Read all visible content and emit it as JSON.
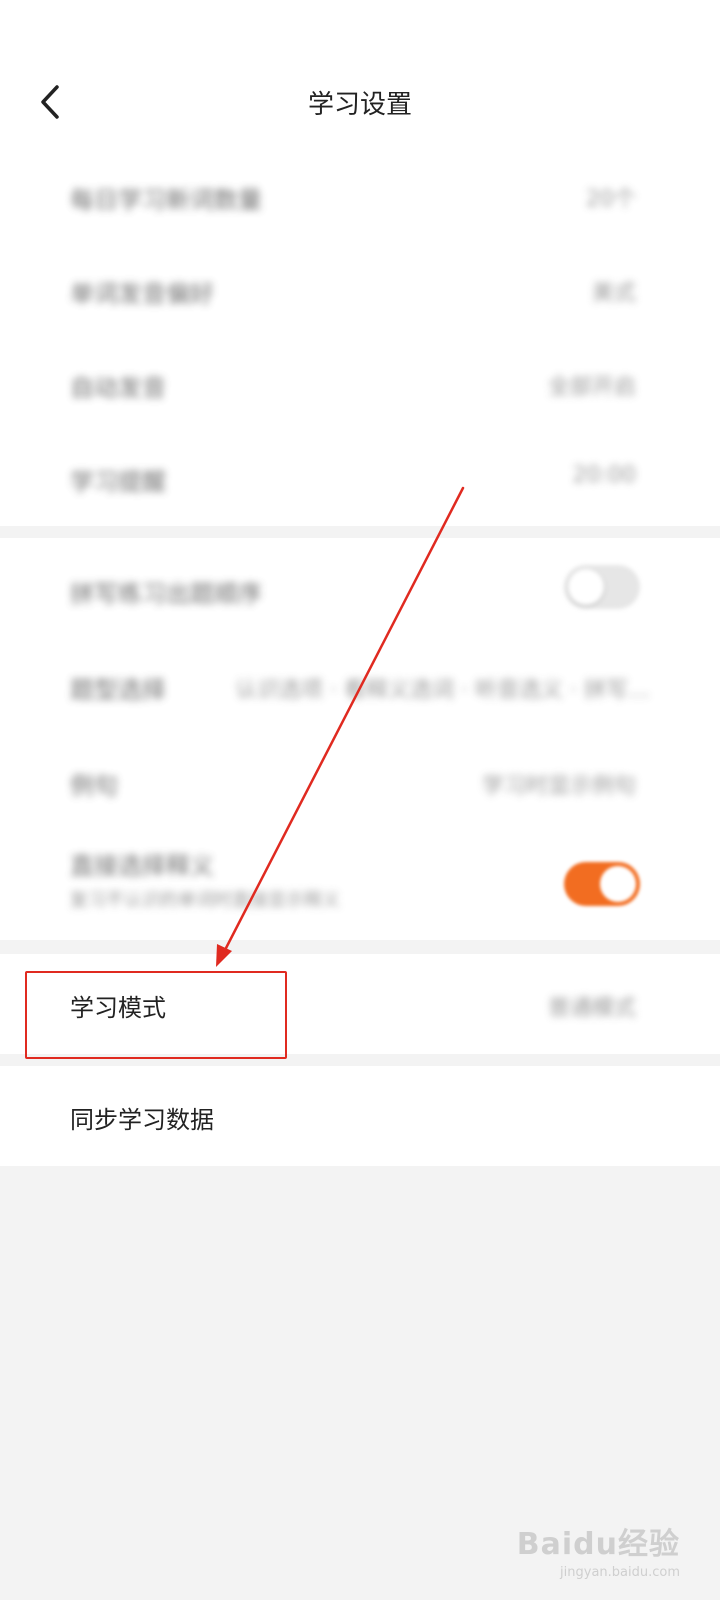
{
  "header": {
    "title": "学习设置",
    "back_icon": "chevron-left-icon"
  },
  "section1": {
    "rows": [
      {
        "label": "每日学习新词数量",
        "value": "20个"
      },
      {
        "label": "单词发音偏好",
        "value": "美式"
      },
      {
        "label": "自动发音",
        "value": "全部开启"
      },
      {
        "label": "学习提醒",
        "value": "20:00"
      }
    ]
  },
  "section2": {
    "rows": [
      {
        "label": "拼写练习出题顺序",
        "toggle": "off"
      },
      {
        "label": "题型选择",
        "value": "认识选项 · 看释义选词 · 听音选义 · 拼写…"
      },
      {
        "label": "例句",
        "value": "学习时显示例句"
      },
      {
        "label": "直接选择释义",
        "sublabel": "复习不认识的单词时直接显示释义",
        "toggle": "on"
      }
    ]
  },
  "mode_row": {
    "label": "学习模式",
    "value": "普通模式"
  },
  "sync_row": {
    "label": "同步学习数据"
  },
  "annotation": {
    "arrow_color": "#e02a20",
    "box_color": "#e02a20"
  },
  "colors": {
    "accent": "#f26d21",
    "background": "#f3f3f3",
    "card": "#ffffff"
  },
  "watermark": {
    "main": "Baidu经验",
    "sub": "jingyan.baidu.com"
  }
}
